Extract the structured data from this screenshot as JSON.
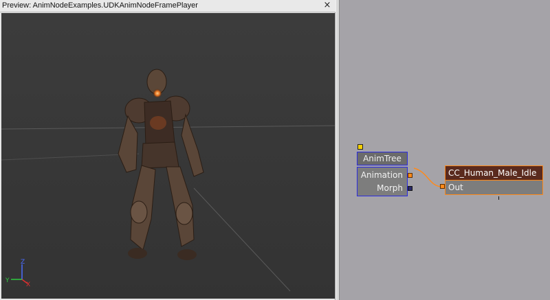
{
  "preview": {
    "title": "Preview: AnimNodeExamples.UDKAnimNodeFramePlayer",
    "close_glyph": "×"
  },
  "viewport": {
    "axes": {
      "z": "Z",
      "y": "Y",
      "x": "X"
    },
    "colors": {
      "background": "#3a3a3a",
      "grid": "#4a4a4a",
      "axis_z": "#4a6cff",
      "axis_y": "#2ecc40",
      "axis_x": "#e03030"
    }
  },
  "graph": {
    "animtree": {
      "title": "AnimTree",
      "ports": [
        "Animation",
        "Morph"
      ]
    },
    "sequence": {
      "title": "CC_Human_Male_Idle",
      "port": "Out"
    },
    "colors": {
      "background": "#a5a3a8",
      "wire": "#ff8a1a",
      "node_border_blue": "#2a2ae0",
      "node_border_orange": "#ff8a1a",
      "pin_yellow": "#f5d000"
    }
  }
}
